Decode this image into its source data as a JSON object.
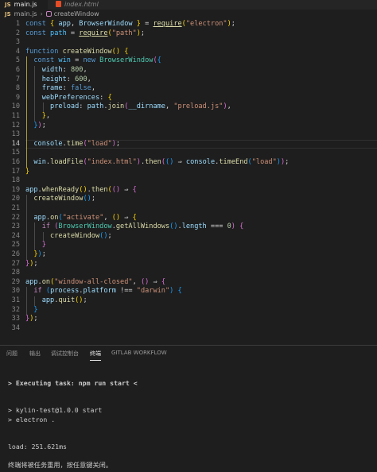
{
  "tabs": [
    {
      "icon": "js-file-icon",
      "icon_text": "JS",
      "label": "main.js",
      "active": true
    },
    {
      "icon": "html-file-icon",
      "label": "index.html",
      "active": false
    }
  ],
  "breadcrumb": {
    "file_icon_text": "JS",
    "file": "main.js",
    "symbol": "createWindow"
  },
  "editor_lines": [
    {
      "num": "1",
      "tokens": [
        [
          "k",
          "const "
        ],
        [
          "p1",
          "{ "
        ],
        [
          "v",
          "app"
        ],
        [
          "o",
          ", "
        ],
        [
          "v",
          "BrowserWindow"
        ],
        [
          "p1",
          " }"
        ],
        [
          "o",
          " = "
        ],
        [
          "f",
          "require"
        ],
        [
          "p1",
          "("
        ],
        [
          "s",
          "\"electron\""
        ],
        [
          "p1",
          ")"
        ],
        [
          "o",
          ";"
        ]
      ]
    },
    {
      "num": "2",
      "tokens": [
        [
          "k",
          "const "
        ],
        [
          "c",
          "path"
        ],
        [
          "o",
          " = "
        ],
        [
          "f",
          "require"
        ],
        [
          "p1",
          "("
        ],
        [
          "s",
          "\"path\""
        ],
        [
          "p1",
          ")"
        ],
        [
          "o",
          ";"
        ]
      ]
    },
    {
      "num": "3",
      "tokens": []
    },
    {
      "num": "4",
      "tokens": [
        [
          "k",
          "function "
        ],
        [
          "f",
          "createWindow"
        ],
        [
          "p1",
          "() {"
        ]
      ]
    },
    {
      "num": "5",
      "tokens": [
        [
          "o",
          "  "
        ],
        [
          "k",
          "const "
        ],
        [
          "c",
          "win"
        ],
        [
          "o",
          " = "
        ],
        [
          "k",
          "new "
        ],
        [
          "cls",
          "BrowserWindow"
        ],
        [
          "p2",
          "("
        ],
        [
          "p3",
          "{"
        ]
      ]
    },
    {
      "num": "6",
      "tokens": [
        [
          "o",
          "    "
        ],
        [
          "v",
          "width"
        ],
        [
          "o",
          ": "
        ],
        [
          "n",
          "800"
        ],
        [
          "o",
          ","
        ]
      ]
    },
    {
      "num": "7",
      "tokens": [
        [
          "o",
          "    "
        ],
        [
          "v",
          "height"
        ],
        [
          "o",
          ": "
        ],
        [
          "n",
          "600"
        ],
        [
          "o",
          ","
        ]
      ]
    },
    {
      "num": "8",
      "tokens": [
        [
          "o",
          "    "
        ],
        [
          "v",
          "frame"
        ],
        [
          "o",
          ": "
        ],
        [
          "k",
          "false"
        ],
        [
          "o",
          ","
        ]
      ]
    },
    {
      "num": "9",
      "tokens": [
        [
          "o",
          "    "
        ],
        [
          "v",
          "webPreferences"
        ],
        [
          "o",
          ": "
        ],
        [
          "p1",
          "{"
        ]
      ]
    },
    {
      "num": "10",
      "tokens": [
        [
          "o",
          "      "
        ],
        [
          "v",
          "preload"
        ],
        [
          "o",
          ": "
        ],
        [
          "v",
          "path"
        ],
        [
          "o",
          "."
        ],
        [
          "f",
          "join"
        ],
        [
          "p2",
          "("
        ],
        [
          "v",
          "__dirname"
        ],
        [
          "o",
          ", "
        ],
        [
          "s",
          "\"preload.js\""
        ],
        [
          "p2",
          ")"
        ],
        [
          "o",
          ","
        ]
      ]
    },
    {
      "num": "11",
      "tokens": [
        [
          "o",
          "    "
        ],
        [
          "p1",
          "}"
        ],
        [
          "o",
          ","
        ]
      ]
    },
    {
      "num": "12",
      "tokens": [
        [
          "o",
          "  "
        ],
        [
          "p3",
          "}"
        ],
        [
          "p2",
          ")"
        ],
        [
          "o",
          ";"
        ]
      ]
    },
    {
      "num": "13",
      "tokens": []
    },
    {
      "num": "14",
      "tokens": [
        [
          "o",
          "  "
        ],
        [
          "v",
          "console"
        ],
        [
          "o",
          "."
        ],
        [
          "f",
          "time"
        ],
        [
          "p2",
          "("
        ],
        [
          "s",
          "\"load\""
        ],
        [
          "p2",
          ")"
        ],
        [
          "o",
          ";"
        ]
      ]
    },
    {
      "num": "15",
      "tokens": []
    },
    {
      "num": "16",
      "tokens": [
        [
          "o",
          "  "
        ],
        [
          "v",
          "win"
        ],
        [
          "o",
          "."
        ],
        [
          "f",
          "loadFile"
        ],
        [
          "p2",
          "("
        ],
        [
          "s",
          "\"index.html\""
        ],
        [
          "p2",
          ")"
        ],
        [
          "o",
          "."
        ],
        [
          "f",
          "then"
        ],
        [
          "p2",
          "("
        ],
        [
          "p3",
          "()"
        ],
        [
          "o",
          " ⇒ "
        ],
        [
          "v",
          "console"
        ],
        [
          "o",
          "."
        ],
        [
          "f",
          "timeEnd"
        ],
        [
          "p3",
          "("
        ],
        [
          "s",
          "\"load\""
        ],
        [
          "p3",
          ")"
        ],
        [
          "p2",
          ")"
        ],
        [
          "o",
          ";"
        ]
      ]
    },
    {
      "num": "17",
      "tokens": [
        [
          "p1",
          "}"
        ]
      ]
    },
    {
      "num": "18",
      "tokens": []
    },
    {
      "num": "19",
      "tokens": [
        [
          "v",
          "app"
        ],
        [
          "o",
          "."
        ],
        [
          "f",
          "whenReady"
        ],
        [
          "p1",
          "()"
        ],
        [
          "o",
          "."
        ],
        [
          "f",
          "then"
        ],
        [
          "p1",
          "("
        ],
        [
          "p2",
          "()"
        ],
        [
          "o",
          " ⇒ "
        ],
        [
          "p2",
          "{"
        ]
      ]
    },
    {
      "num": "20",
      "tokens": [
        [
          "o",
          "  "
        ],
        [
          "f",
          "createWindow"
        ],
        [
          "p3",
          "()"
        ],
        [
          "o",
          ";"
        ]
      ]
    },
    {
      "num": "21",
      "tokens": []
    },
    {
      "num": "22",
      "tokens": [
        [
          "o",
          "  "
        ],
        [
          "v",
          "app"
        ],
        [
          "o",
          "."
        ],
        [
          "f",
          "on"
        ],
        [
          "p3",
          "("
        ],
        [
          "s",
          "\"activate\""
        ],
        [
          "o",
          ", "
        ],
        [
          "p1",
          "()"
        ],
        [
          "o",
          " ⇒ "
        ],
        [
          "p1",
          "{"
        ]
      ]
    },
    {
      "num": "23",
      "tokens": [
        [
          "o",
          "    "
        ],
        [
          "kc",
          "if "
        ],
        [
          "p2",
          "("
        ],
        [
          "cls",
          "BrowserWindow"
        ],
        [
          "o",
          "."
        ],
        [
          "f",
          "getAllWindows"
        ],
        [
          "p3",
          "()"
        ],
        [
          "o",
          "."
        ],
        [
          "v",
          "length"
        ],
        [
          "o",
          " === "
        ],
        [
          "n",
          "0"
        ],
        [
          "p2",
          ")"
        ],
        [
          "o",
          " "
        ],
        [
          "p2",
          "{"
        ]
      ]
    },
    {
      "num": "24",
      "tokens": [
        [
          "o",
          "      "
        ],
        [
          "f",
          "createWindow"
        ],
        [
          "p3",
          "()"
        ],
        [
          "o",
          ";"
        ]
      ]
    },
    {
      "num": "25",
      "tokens": [
        [
          "o",
          "    "
        ],
        [
          "p2",
          "}"
        ]
      ]
    },
    {
      "num": "26",
      "tokens": [
        [
          "o",
          "  "
        ],
        [
          "p1",
          "}"
        ],
        [
          "p3",
          ")"
        ],
        [
          "o",
          ";"
        ]
      ]
    },
    {
      "num": "27",
      "tokens": [
        [
          "p2",
          "}"
        ],
        [
          "p1",
          ")"
        ],
        [
          "o",
          ";"
        ]
      ]
    },
    {
      "num": "28",
      "tokens": []
    },
    {
      "num": "29",
      "tokens": [
        [
          "v",
          "app"
        ],
        [
          "o",
          "."
        ],
        [
          "f",
          "on"
        ],
        [
          "p1",
          "("
        ],
        [
          "s",
          "\"window-all-closed\""
        ],
        [
          "o",
          ", "
        ],
        [
          "p2",
          "()"
        ],
        [
          "o",
          " ⇒ "
        ],
        [
          "p2",
          "{"
        ]
      ]
    },
    {
      "num": "30",
      "tokens": [
        [
          "o",
          "  "
        ],
        [
          "kc",
          "if "
        ],
        [
          "p3",
          "("
        ],
        [
          "v",
          "process"
        ],
        [
          "o",
          "."
        ],
        [
          "v",
          "platform"
        ],
        [
          "o",
          " !== "
        ],
        [
          "s",
          "\"darwin\""
        ],
        [
          "p3",
          ")"
        ],
        [
          "o",
          " "
        ],
        [
          "p3",
          "{"
        ]
      ]
    },
    {
      "num": "31",
      "tokens": [
        [
          "o",
          "    "
        ],
        [
          "v",
          "app"
        ],
        [
          "o",
          "."
        ],
        [
          "f",
          "quit"
        ],
        [
          "p1",
          "()"
        ],
        [
          "o",
          ";"
        ]
      ]
    },
    {
      "num": "32",
      "tokens": [
        [
          "o",
          "  "
        ],
        [
          "p3",
          "}"
        ]
      ]
    },
    {
      "num": "33",
      "tokens": [
        [
          "p2",
          "}"
        ],
        [
          "p1",
          ")"
        ],
        [
          "o",
          ";"
        ]
      ]
    },
    {
      "num": "34",
      "tokens": []
    }
  ],
  "current_line": "14",
  "panel_tabs": [
    "问题",
    "输出",
    "调试控制台",
    "终端",
    "GITLAB WORKFLOW"
  ],
  "active_panel_tab": "终端",
  "terminal_lines": [
    {
      "text": "",
      "bold": false
    },
    {
      "text": "> Executing task: npm run start <",
      "bold": true
    },
    {
      "text": "",
      "bold": false
    },
    {
      "text": "",
      "bold": false
    },
    {
      "text": "> kylin-test@1.0.0 start",
      "bold": false
    },
    {
      "text": "> electron .",
      "bold": false
    },
    {
      "text": "",
      "bold": false
    },
    {
      "text": "",
      "bold": false
    },
    {
      "text": "load: 251.621ms",
      "bold": false
    },
    {
      "text": "",
      "bold": false
    },
    {
      "text": "终端将被任务重用，按任意键关闭。",
      "bold": false
    }
  ],
  "colors": {
    "background": "#1e1e1e",
    "tabbar": "#252526",
    "line_number": "#858585",
    "keyword": "#569cd6",
    "function": "#dcdcaa",
    "string": "#ce9178",
    "number": "#b5cea8",
    "class": "#4ec9b0"
  }
}
